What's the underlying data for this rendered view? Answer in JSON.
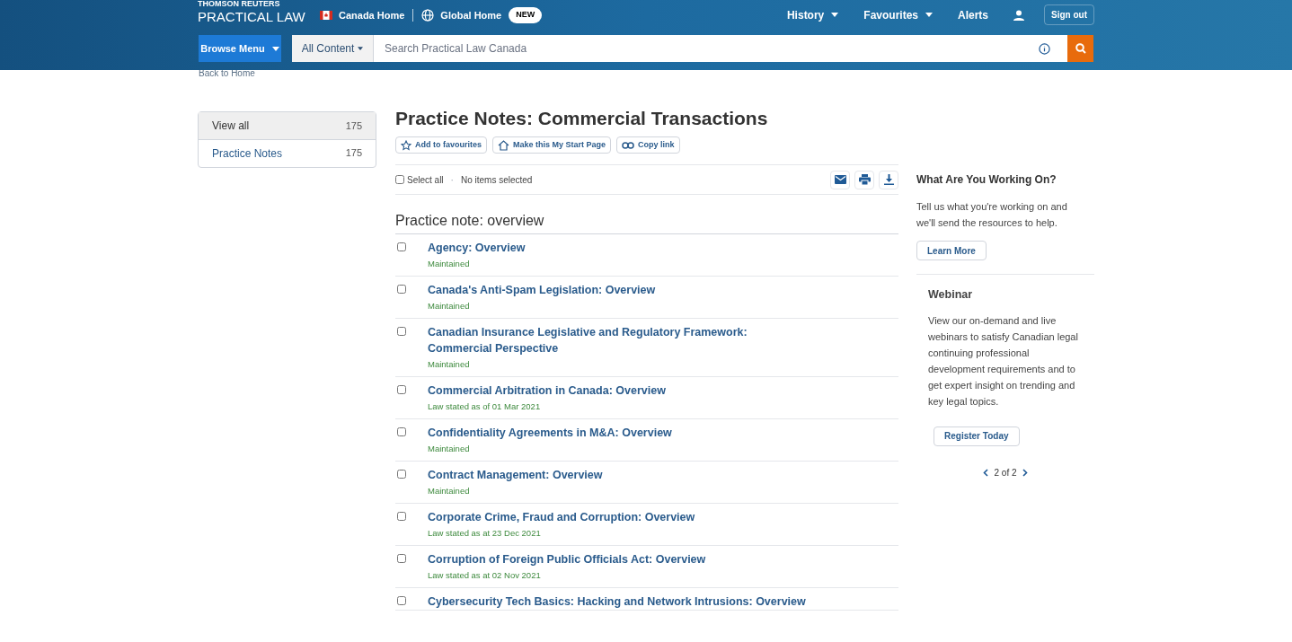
{
  "header": {
    "brand_top": "THOMSON REUTERS",
    "brand": "PRACTICAL LAW",
    "links": [
      {
        "kind": "flag",
        "label": "Canada Home"
      },
      {
        "kind": "globe",
        "label": "Global Home",
        "badge": "NEW"
      }
    ],
    "nav": [
      {
        "label": "History",
        "dropdown": true
      },
      {
        "label": "Favourites",
        "dropdown": true
      },
      {
        "label": "Alerts",
        "dropdown": false
      }
    ],
    "sign_out": "Sign out",
    "browse": "Browse Menu",
    "scope": "All Content",
    "search": {
      "placeholder": "Search Practical Law Canada"
    }
  },
  "back": "Back to Home",
  "sidebar": {
    "items": [
      {
        "label": "View all",
        "count": "175",
        "selected": true
      },
      {
        "label": "Practice Notes",
        "count": "175",
        "selected": false
      }
    ]
  },
  "page": {
    "title": "Practice Notes: Commercial Transactions",
    "actions": [
      {
        "kind": "star",
        "label": "Add to favourites"
      },
      {
        "kind": "home",
        "label": "Make this My Start Page"
      },
      {
        "kind": "link",
        "label": "Copy link"
      }
    ],
    "select_all": {
      "label": "Select all",
      "checked": false
    },
    "separator": "·",
    "selection": "No items selected",
    "section": "Practice note: overview",
    "items": [
      {
        "title": "Agency: Overview",
        "status": "Maintained",
        "checked": false
      },
      {
        "title": "Canada's Anti-Spam Legislation: Overview",
        "status": "Maintained",
        "checked": false
      },
      {
        "title": "Canadian Insurance Legislative and Regulatory Framework: Commercial Perspective",
        "status": "Maintained",
        "checked": false
      },
      {
        "title": "Commercial Arbitration in Canada: Overview",
        "status": "Law stated as of 01 Mar 2021",
        "checked": false
      },
      {
        "title": "Confidentiality Agreements in M&A: Overview",
        "status": "Maintained",
        "checked": false
      },
      {
        "title": "Contract Management: Overview",
        "status": "Maintained",
        "checked": false
      },
      {
        "title": "Corporate Crime, Fraud and Corruption: Overview",
        "status": "Law stated as at 23 Dec 2021",
        "checked": false
      },
      {
        "title": "Corruption of Foreign Public Officials Act: Overview",
        "status": "Law stated as at 02 Nov 2021",
        "checked": false
      },
      {
        "title": "Cybersecurity Tech Basics: Hacking and Network Intrusions: Overview",
        "checked": false
      }
    ]
  },
  "aside": {
    "promo": {
      "title": "What Are You Working On?",
      "text": "Tell us what you're working on and we'll send the resources to help.",
      "button": "Learn More"
    },
    "webinar": {
      "title": "Webinar",
      "text": "View our on-demand and live webinars to satisfy Canadian legal continuing professional development requirements and to get expert insight on trending and key legal topics.",
      "button": "Register Today"
    },
    "pager": "2 of 2"
  }
}
